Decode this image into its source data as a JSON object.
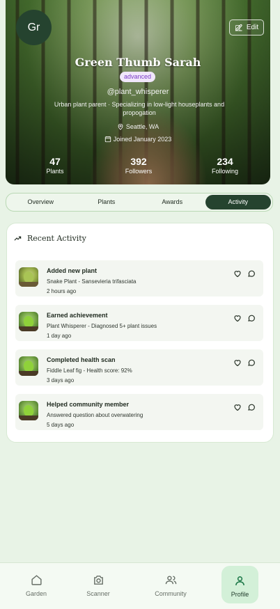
{
  "profile": {
    "avatar_initials": "Gr",
    "edit_label": "Edit",
    "name": "Green Thumb Sarah",
    "level": "advanced",
    "handle": "@plant_whisperer",
    "bio": "Urban plant parent · Specializing in low-light houseplants and propogation",
    "location": "Seattle, WA",
    "joined": "Joined January 2023",
    "stats": [
      {
        "value": "47",
        "label": "Plants"
      },
      {
        "value": "392",
        "label": "Followers"
      },
      {
        "value": "234",
        "label": "Following"
      }
    ]
  },
  "tabs": [
    "Overview",
    "Plants",
    "Awards",
    "Activity"
  ],
  "active_tab": "Activity",
  "activity": {
    "title": "Recent Activity",
    "items": [
      {
        "title": "Added new plant",
        "detail": "Snake Plant - Sansevieria trifasciata",
        "time": "2 hours ago",
        "thumb": "plant-photo"
      },
      {
        "title": "Earned achievement",
        "detail": "Plant Whisperer - Diagnosed 5+ plant issues",
        "time": "1 day ago",
        "thumb": "sprout"
      },
      {
        "title": "Completed health scan",
        "detail": "Fiddle Leaf fig - Health score: 92%",
        "time": "3 days ago",
        "thumb": "sprout"
      },
      {
        "title": "Helped community member",
        "detail": "Answered question about overwatering",
        "time": "5 days ago",
        "thumb": "sprout"
      }
    ]
  },
  "nav": [
    {
      "label": "Garden",
      "icon": "home-icon"
    },
    {
      "label": "Scanner",
      "icon": "camera-icon"
    },
    {
      "label": "Community",
      "icon": "users-icon"
    },
    {
      "label": "Profile",
      "icon": "user-icon"
    }
  ],
  "colors": {
    "primary_dark": "#25432f",
    "background": "#e8f3e6",
    "level_badge_bg": "#f1e7fb",
    "level_badge_text": "#7a3bc6",
    "nav_active_bg": "#d3f0d8"
  }
}
